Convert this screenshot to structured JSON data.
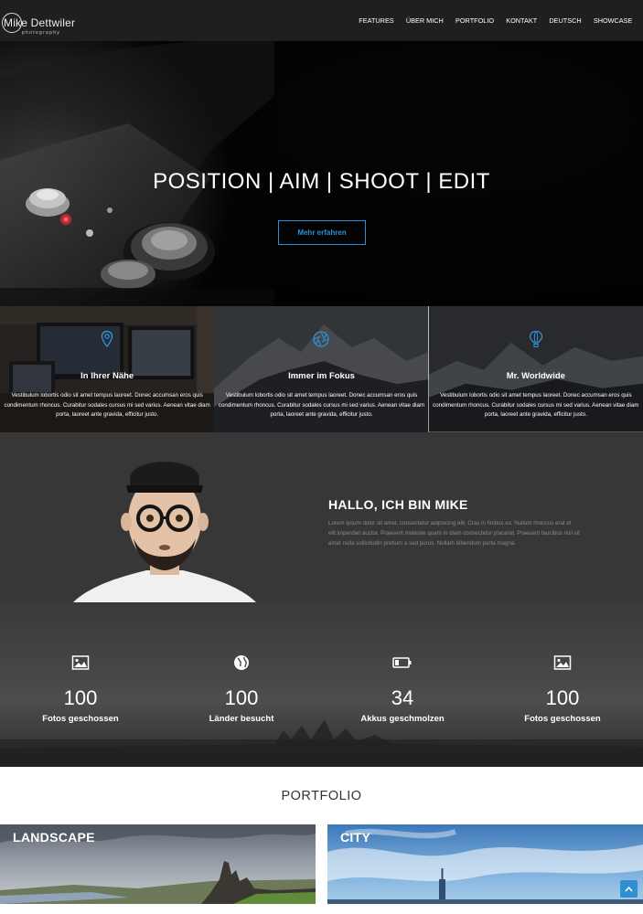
{
  "nav": {
    "logo_name": "Mike Dettwiler",
    "logo_tagline": "photography",
    "links": [
      "FEATURES",
      "ÜBER MICH",
      "PORTFOLIO",
      "KONTAKT",
      "DEUTSCH",
      "SHOWCASE"
    ]
  },
  "hero": {
    "title": "POSITION | AIM | SHOOT | EDIT",
    "button_label": "Mehr erfahren",
    "accent_color": "#2f8fd0"
  },
  "features": [
    {
      "icon": "map-marker-icon",
      "title": "In Ihrer Nähe",
      "text": "Vestibulum lobortis odio sit amet tempus laoreet. Donec accumsan eros quis condimentum rhoncus. Curabitur sodales cursus mi sed varius. Aenean vitae diam porta, laoreet ante gravida, efficitur justo."
    },
    {
      "icon": "aperture-icon",
      "title": "Immer im Fokus",
      "text": "Vestibulum lobortis odio sit amet tempus laoreet. Donec accumsan eros quis condimentum rhoncus. Curabitur sodales cursus mi sed varius. Aenean vitae diam porta, laoreet ante gravida, efficitur justo."
    },
    {
      "icon": "hot-air-balloon-icon",
      "title": "Mr. Worldwide",
      "text": "Vestibulum lobortis odio sit amet tempus laoreet. Donec accumsan eros quis condimentum rhoncus. Curabitur sodales cursus mi sed varius. Aenean vitae diam porta, laoreet ante gravida, efficitur justo."
    }
  ],
  "about": {
    "title": "HALLO, ICH BIN MIKE",
    "text": "Lorem ipsum dolor sit amet, consectetur adipiscing elit. Cras in finibus ex. Nullam rhoncus erat et elit imperdiet auctor. Praesent molestie quam in diam consectetur placerat. Praesent faucibus nisl sit amet nulla sollicitudin pretium a sed purus. Nullam bibendum porta magna."
  },
  "stats": [
    {
      "icon": "image-icon",
      "value": "100",
      "label": "Fotos geschossen"
    },
    {
      "icon": "globe-icon",
      "value": "100",
      "label": "Länder besucht"
    },
    {
      "icon": "battery-icon",
      "value": "34",
      "label": "Akkus geschmolzen"
    },
    {
      "icon": "image-icon",
      "value": "100",
      "label": "Fotos geschossen"
    }
  ],
  "portfolio": {
    "title": "PORTFOLIO",
    "cards": [
      {
        "label": "LANDSCAPE"
      },
      {
        "label": "CITY"
      }
    ]
  }
}
